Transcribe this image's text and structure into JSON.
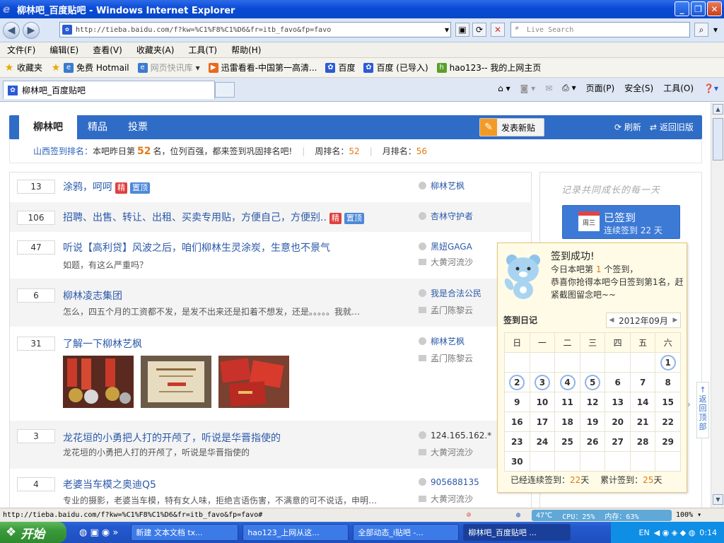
{
  "window": {
    "title": "柳林吧_百度贴吧 - Windows Internet Explorer",
    "ie_glyph": "e"
  },
  "address": {
    "url": "http://tieba.baidu.com/f?kw=%C1%F8%C1%D6&fr=itb_favo&fp=favo",
    "search_placeholder": "Live Search"
  },
  "menu": [
    "文件(F)",
    "编辑(E)",
    "查看(V)",
    "收藏夹(A)",
    "工具(T)",
    "帮助(H)"
  ],
  "favorites": {
    "label": "收藏夹",
    "items": [
      "免费 Hotmail",
      "网页快讯库",
      "迅雷看看-中国第一高清...",
      "百度",
      "百度 (已导入)",
      "hao123-- 我的上网主页"
    ]
  },
  "tab": {
    "title": "柳林吧_百度贴吧"
  },
  "commandbar": {
    "page": "页面(P)",
    "safety": "安全(S)",
    "tools": "工具(O)"
  },
  "forum": {
    "tabs": [
      "柳林吧",
      "精品",
      "投票"
    ],
    "post_button": "发表新贴",
    "refresh": "刷新",
    "back_old": "返回旧版",
    "rank": {
      "prefix": "山西签到排名：",
      "text1": "本吧昨日第",
      "yesterday": "52",
      "text2": "名，位列百强，都来签到巩固排名吧!",
      "week_label": "周排名：",
      "week": "52",
      "month_label": "月排名：",
      "month": "56"
    }
  },
  "threads": [
    {
      "count": "13",
      "title": "涂鸦，呵呵",
      "tags": [
        "精",
        "置顶"
      ],
      "author": "柳林艺枫",
      "abstract": "",
      "last": ""
    },
    {
      "count": "106",
      "title": "招聘、出售、转让、出租、买卖专用贴，方便自己，方便别..",
      "tags": [
        "精",
        "置顶"
      ],
      "author": "杏林守护者",
      "abstract": "",
      "last": ""
    },
    {
      "count": "47",
      "title": "听说【高利贷】风波之后，咱们柳林生灵涂炭，生意也不景气",
      "tags": [],
      "author": "黑妞GAGA",
      "abstract": "如题，有这么严重吗？",
      "last": "大黄河流沙"
    },
    {
      "count": "6",
      "title": "柳林凌志集团",
      "tags": [],
      "author": "我是合法公民",
      "abstract": "怎么，四五个月的工资都不发，是发不出来还是扣着不想发，还是。。。。。我就…",
      "last": "孟门陈黎云"
    },
    {
      "count": "31",
      "title": "了解一下柳林艺枫",
      "tags": [],
      "author": "柳林艺枫",
      "abstract": "",
      "last": "孟门陈黎云"
    },
    {
      "count": "3",
      "title": "龙花垣的小勇把人打的开颅了，听说是华晋指使的",
      "tags": [],
      "author": "124.165.162.*",
      "abstract": "龙花垣的小勇把人打的开颅了，听说是华晋指使的",
      "last": "大黄河流沙"
    },
    {
      "count": "4",
      "title": "老婆当车模之奥迪Q5",
      "tags": [],
      "author": "905688135",
      "abstract": "专业的摄影，老婆当车模，特有女人味，拒绝言语伤害，不满意的可不说话，申明…",
      "last": "大黄河流沙"
    }
  ],
  "sidebar": {
    "slogan": "记录共同成长的每一天",
    "signed": "已签到",
    "streak_text": "连续签到 22 天",
    "cal_weekday": "周三"
  },
  "popup": {
    "title": "签到成功!",
    "line1a": "今日本吧第",
    "line1n": "1",
    "line1b": "个签到，",
    "line2": "恭喜你抢得本吧今日签到第1名，赶紧截图留念吧~~",
    "diary": "签到日记",
    "month": "2012年09月",
    "weekdays": [
      "日",
      "一",
      "二",
      "三",
      "四",
      "五",
      "六"
    ],
    "days": [
      "",
      "",
      "",
      "",
      "",
      "",
      "1",
      "2",
      "3",
      "4",
      "5",
      "6",
      "7",
      "8",
      "9",
      "10",
      "11",
      "12",
      "13",
      "14",
      "15",
      "16",
      "17",
      "18",
      "19",
      "20",
      "21",
      "22",
      "23",
      "24",
      "25",
      "26",
      "27",
      "28",
      "29",
      "30"
    ],
    "signed_days": [
      "1",
      "2",
      "3",
      "4",
      "5"
    ],
    "continuous_label": "已经连续签到：",
    "continuous": "22",
    "total_label": "累计签到：",
    "total": "25",
    "day_unit": "天"
  },
  "back_to_top": "返回顶部",
  "statusbar": {
    "url": "http://tieba.baidu.com/f?kw=%C1%F8%C1%D6&fr=itb_favo&fp=favo#",
    "temp": "47℃",
    "cpu": "CPU：25%",
    "mem": "内存：63%",
    "zoom": "100%"
  },
  "taskbar": {
    "start": "开始",
    "items": [
      "新建 文本文档 tx...",
      "hao123_上网从这...",
      "全部动态_i贴吧 -...",
      "柳林吧_百度贴吧 ..."
    ],
    "lang": "EN",
    "time": "0:14"
  }
}
